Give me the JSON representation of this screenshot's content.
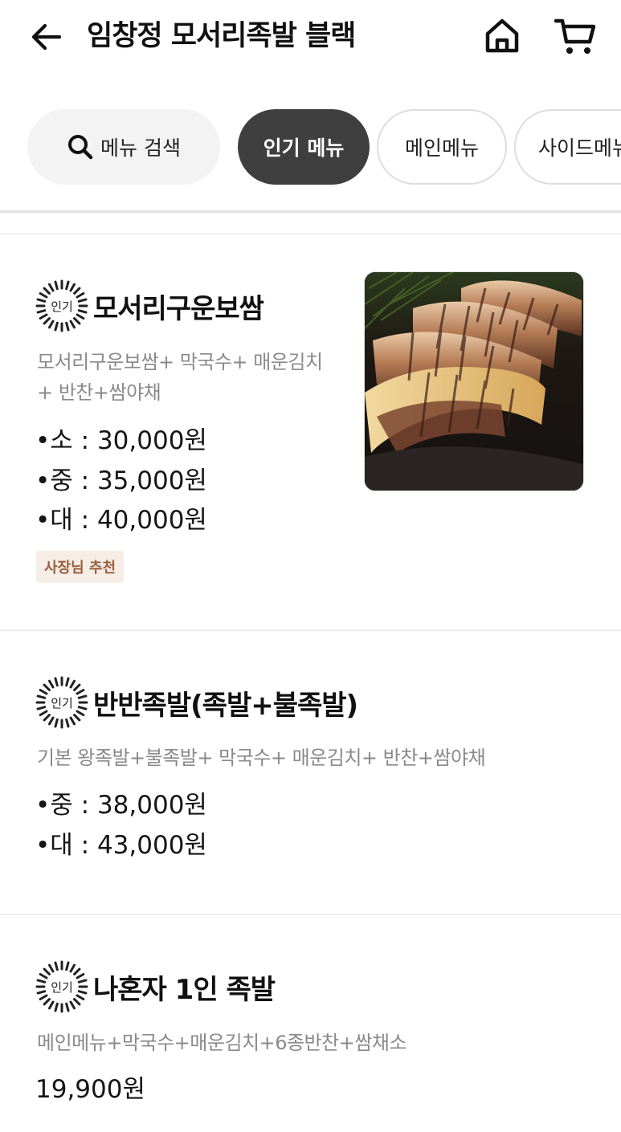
{
  "header": {
    "title": "임창정 모서리족발 블랙",
    "back_icon": "arrow-left-icon",
    "home_icon": "home-icon",
    "cart_icon": "cart-icon"
  },
  "tabs": {
    "search_label": "메뉴 검색",
    "search_icon": "search-icon",
    "items": [
      {
        "label": "인기 메뉴",
        "active": true
      },
      {
        "label": "메인메뉴",
        "active": false
      },
      {
        "label": "사이드메뉴",
        "active": false
      }
    ]
  },
  "popular_badge_text": "인기",
  "menu": [
    {
      "name": "모서리구운보쌈",
      "description_lines": [
        "모서리구운보쌈+ 막국수+ 매운김치",
        "+ 반찬+쌈야채"
      ],
      "prices": [
        "•소 : 30,000원",
        "•중 : 35,000원",
        "•대 : 40,000원"
      ],
      "badge": "사장님 추천",
      "has_image": true
    },
    {
      "name": "반반족발(족발+불족발)",
      "description_lines": [
        "기본 왕족발+불족발+ 막국수+ 매운김치+ 반찬+쌈야채"
      ],
      "prices": [
        "•중 : 38,000원",
        "•대 : 43,000원"
      ]
    },
    {
      "name": "나혼자 1인 족발",
      "description_lines": [
        "메인메뉴+막국수+매운김치+6종반찬+쌈채소"
      ],
      "prices": [
        "19,900원"
      ]
    }
  ],
  "colors": {
    "active_tab_bg": "#3f3f3f",
    "badge_bg": "#f5ede6",
    "badge_text": "#9a5f3c",
    "description_text": "#8a8a8a"
  }
}
